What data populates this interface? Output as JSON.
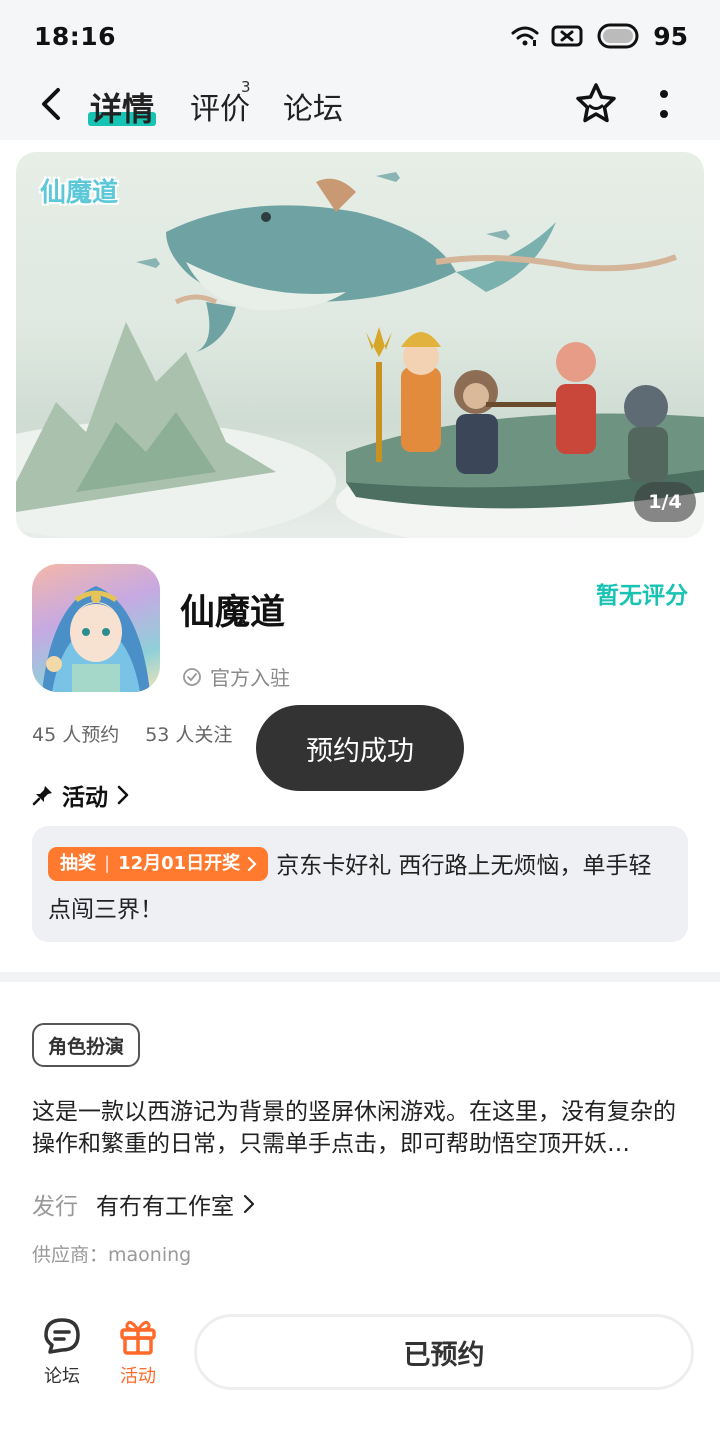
{
  "status_bar": {
    "time": "18:16",
    "battery": "95",
    "icons": [
      "wifi-icon",
      "sim-off-icon",
      "battery-icon"
    ]
  },
  "header": {
    "tabs": [
      {
        "label": "详情",
        "active": true
      },
      {
        "label": "评价",
        "badge": "3"
      },
      {
        "label": "论坛"
      }
    ],
    "icons": [
      "back-icon",
      "star-icon",
      "more-icon"
    ]
  },
  "banner": {
    "logo_text": "仙魔道",
    "page_indicator": "1/4"
  },
  "game": {
    "title": "仙魔道",
    "official_label": "官方入驻",
    "rating_text": "暂无评分",
    "reservations": "45 人预约",
    "followers": "53 人关注"
  },
  "toast": "预约成功",
  "activity": {
    "heading": "活动",
    "badge_label": "抽奖",
    "badge_date": "12月01日开奖",
    "text": "京东卡好礼 西行路上无烦恼，单手轻点闯三界！"
  },
  "details": {
    "genre": "角色扮演",
    "description": "这是一款以西游记为背景的竖屏休闲游戏。在这里，没有复杂的操作和繁重的日常，只需单手点击，即可帮助悟空顶开妖…",
    "publisher_label": "发行",
    "publisher_name": "有冇有工作室",
    "supplier": "供应商：maoning"
  },
  "bottom_bar": {
    "forum_label": "论坛",
    "activity_label": "活动",
    "reserve_button": "已预约"
  },
  "colors": {
    "accent_teal": "#17c3b2",
    "accent_orange": "#ff7a2f",
    "toast_bg": "#333333"
  }
}
